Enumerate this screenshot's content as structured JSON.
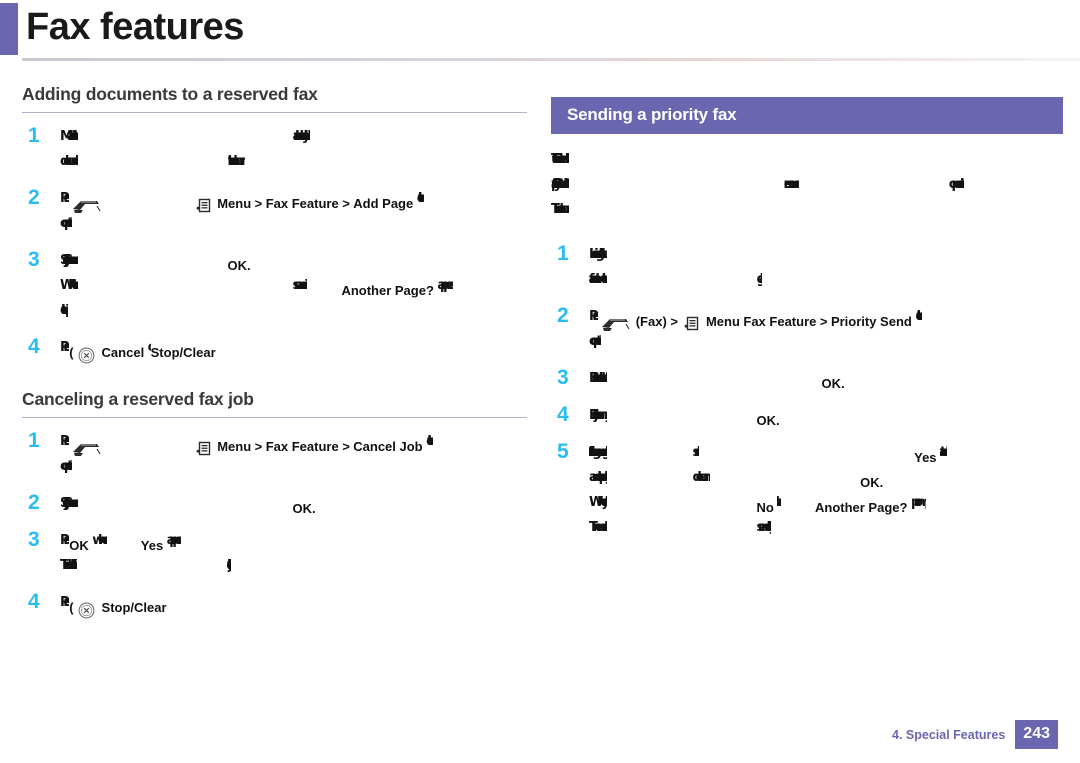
{
  "document": {
    "title": "Fax features",
    "accent_color": "#6b66b0",
    "step_number_color": "#29bdef"
  },
  "left_column": {
    "sections": [
      {
        "heading": "Adding documents to a reserved fax",
        "style": "underlined",
        "steps": [
          {
            "number": "1",
            "lines": [
              {
                "parts": [
                  {
                    "type": "faint",
                    "text": "Make sure that the document is"
                  },
                  {
                    "type": "gap",
                    "size": "xl"
                  },
                  {
                    "type": "faint",
                    "text": "already loaded in the"
                  }
                ]
              },
              {
                "parts": [
                  {
                    "type": "faint",
                    "text": "document feeder. If not, load"
                  },
                  {
                    "type": "gap",
                    "size": "l"
                  },
                  {
                    "type": "faint",
                    "text": "the document."
                  }
                ]
              }
            ]
          },
          {
            "number": "2",
            "lines": [
              {
                "parts": [
                  {
                    "type": "faint",
                    "text": "Press"
                  },
                  {
                    "type": "icon",
                    "name": "fax-icon"
                  },
                  {
                    "type": "gap",
                    "size": "m"
                  },
                  {
                    "type": "icon",
                    "name": "menu-icon"
                  },
                  {
                    "type": "label",
                    "text": "Menu"
                  },
                  {
                    "type": "label",
                    "text": ">"
                  },
                  {
                    "type": "label",
                    "text": "Fax Feature"
                  },
                  {
                    "type": "label",
                    "text": ">"
                  },
                  {
                    "type": "label",
                    "text": "Add Page"
                  },
                  {
                    "type": "faint",
                    "text": "on the"
                  }
                ]
              },
              {
                "parts": [
                  {
                    "type": "faint",
                    "text": "control panel."
                  }
                ]
              }
            ]
          },
          {
            "number": "3",
            "lines": [
              {
                "parts": [
                  {
                    "type": "faint",
                    "text": "Select the fax job you want and press"
                  },
                  {
                    "type": "gap",
                    "size": "l"
                  },
                  {
                    "type": "label",
                    "text": "OK."
                  }
                ]
              },
              {
                "parts": [
                  {
                    "type": "faint",
                    "text": "When the machine has finished"
                  },
                  {
                    "type": "gap",
                    "size": "xl"
                  },
                  {
                    "type": "faint",
                    "text": "scanning,"
                  },
                  {
                    "type": "gap",
                    "size": "s"
                  },
                  {
                    "type": "label",
                    "text": "Another Page?"
                  },
                  {
                    "type": "faint",
                    "text": "appears"
                  }
                ]
              },
              {
                "parts": [
                  {
                    "type": "faint",
                    "text": "on the display."
                  }
                ]
              }
            ]
          },
          {
            "number": "4",
            "lines": [
              {
                "parts": [
                  {
                    "type": "faint",
                    "text": "Press"
                  },
                  {
                    "type": "plain",
                    "text": "("
                  },
                  {
                    "type": "icon",
                    "name": "stop-clear-icon"
                  },
                  {
                    "type": "label",
                    "text": "Cancel"
                  },
                  {
                    "type": "faint",
                    "text": "or"
                  },
                  {
                    "type": "label",
                    "text": "Stop/Clear"
                  },
                  {
                    "type": "faint",
                    "text": ") to exit."
                  }
                ]
              }
            ]
          }
        ]
      },
      {
        "heading": "Canceling a reserved fax job",
        "style": "underlined",
        "steps": [
          {
            "number": "1",
            "lines": [
              {
                "parts": [
                  {
                    "type": "faint",
                    "text": "Press"
                  },
                  {
                    "type": "icon",
                    "name": "fax-icon"
                  },
                  {
                    "type": "gap",
                    "size": "m"
                  },
                  {
                    "type": "icon",
                    "name": "menu-icon"
                  },
                  {
                    "type": "label",
                    "text": "Menu"
                  },
                  {
                    "type": "label",
                    "text": ">"
                  },
                  {
                    "type": "label",
                    "text": "Fax Feature"
                  },
                  {
                    "type": "label",
                    "text": ">"
                  },
                  {
                    "type": "label",
                    "text": "Cancel Job"
                  },
                  {
                    "type": "faint",
                    "text": "on the"
                  }
                ]
              },
              {
                "parts": [
                  {
                    "type": "faint",
                    "text": "control panel."
                  }
                ]
              }
            ]
          },
          {
            "number": "2",
            "lines": [
              {
                "parts": [
                  {
                    "type": "faint",
                    "text": "Select the fax job you want and press"
                  },
                  {
                    "type": "gap",
                    "size": "xl"
                  },
                  {
                    "type": "label",
                    "text": "OK."
                  }
                ]
              }
            ]
          },
          {
            "number": "3",
            "lines": [
              {
                "parts": [
                  {
                    "type": "faint",
                    "text": "Press"
                  },
                  {
                    "type": "label",
                    "text": "OK"
                  },
                  {
                    "type": "faint",
                    "text": "when"
                  },
                  {
                    "type": "gap",
                    "size": "s"
                  },
                  {
                    "type": "label",
                    "text": "Yes"
                  },
                  {
                    "type": "faint",
                    "text": "appears."
                  }
                ]
              },
              {
                "parts": [
                  {
                    "type": "faint",
                    "text": "The selected fax is deleted."
                  },
                  {
                    "type": "gap",
                    "size": "l"
                  },
                  {
                    "type": "faint",
                    "text": "the job."
                  }
                ]
              }
            ]
          },
          {
            "number": "4",
            "lines": [
              {
                "parts": [
                  {
                    "type": "faint",
                    "text": "Press"
                  },
                  {
                    "type": "plain",
                    "text": "("
                  },
                  {
                    "type": "icon",
                    "name": "stop-clear-icon"
                  },
                  {
                    "type": "label",
                    "text": "Stop/Clear"
                  },
                  {
                    "type": "faint",
                    "text": ") to exit."
                  }
                ]
              }
            ]
          }
        ]
      }
    ]
  },
  "right_column": {
    "sections": [
      {
        "heading": "Sending a priority fax",
        "style": "boxed",
        "intro_lines": [
          {
            "parts": [
              {
                "type": "faint",
                "text": "This function is used when a high"
              }
            ]
          },
          {
            "parts": [
              {
                "type": "faint",
                "text": "priority fax needs to be sent ahead of"
              },
              {
                "type": "gap",
                "size": "xl"
              },
              {
                "type": "faint",
                "text": "reserved"
              },
              {
                "type": "gap",
                "size": "l"
              },
              {
                "type": "faint",
                "text": "operations."
              }
            ]
          },
          {
            "parts": [
              {
                "type": "faint",
                "text": "The document is scanned into memory."
              }
            ]
          }
        ],
        "steps": [
          {
            "number": "1",
            "lines": [
              {
                "parts": [
                  {
                    "type": "faint",
                    "text": "Load a single document"
                  }
                ]
              },
              {
                "parts": [
                  {
                    "type": "faint",
                    "text": "face down on the scanner"
                  },
                  {
                    "type": "gap",
                    "size": "l"
                  },
                  {
                    "type": "faint",
                    "text": "glass."
                  }
                ]
              }
            ]
          },
          {
            "number": "2",
            "lines": [
              {
                "parts": [
                  {
                    "type": "faint",
                    "text": "Press"
                  },
                  {
                    "type": "icon",
                    "name": "fax-icon"
                  },
                  {
                    "type": "plain",
                    "text": "(Fax) >"
                  },
                  {
                    "type": "icon",
                    "name": "menu-icon"
                  },
                  {
                    "type": "label",
                    "text": "Menu"
                  },
                  {
                    "type": "label",
                    "text": "Fax Feature"
                  },
                  {
                    "type": "label",
                    "text": ">"
                  },
                  {
                    "type": "label",
                    "text": "Priority Send"
                  },
                  {
                    "type": "faint",
                    "text": "on the"
                  }
                ]
              },
              {
                "parts": [
                  {
                    "type": "faint",
                    "text": "control panel."
                  }
                ]
              }
            ]
          },
          {
            "number": "3",
            "lines": [
              {
                "parts": [
                  {
                    "type": "faint",
                    "text": "Enter the destination fax number and press"
                  },
                  {
                    "type": "gap",
                    "size": "xl"
                  },
                  {
                    "type": "label",
                    "text": "OK."
                  }
                ]
              }
            ]
          },
          {
            "number": "4",
            "lines": [
              {
                "parts": [
                  {
                    "type": "faint",
                    "text": "Enter the job name you want and press"
                  },
                  {
                    "type": "gap",
                    "size": "l"
                  },
                  {
                    "type": "label",
                    "text": "OK."
                  }
                ]
              }
            ]
          },
          {
            "number": "5",
            "lines": [
              {
                "parts": [
                  {
                    "type": "faint",
                    "text": "If you are using the scanner glass,"
                  },
                  {
                    "type": "gap",
                    "size": "m"
                  },
                  {
                    "type": "faint",
                    "text": "select"
                  },
                  {
                    "type": "gap",
                    "size": "xl"
                  },
                  {
                    "type": "label",
                    "text": "Yes"
                  },
                  {
                    "type": "faint",
                    "text": "to add"
                  }
                ]
              },
              {
                "parts": [
                  {
                    "type": "faint",
                    "text": "another page. Load another"
                  },
                  {
                    "type": "gap",
                    "size": "m"
                  },
                  {
                    "type": "faint",
                    "text": "document and press"
                  },
                  {
                    "type": "gap",
                    "size": "l"
                  },
                  {
                    "type": "label",
                    "text": "OK."
                  }
                ]
              },
              {
                "parts": [
                  {
                    "type": "faint",
                    "text": "When you have finished, select"
                  },
                  {
                    "type": "gap",
                    "size": "l"
                  },
                  {
                    "type": "label",
                    "text": "No"
                  },
                  {
                    "type": "faint",
                    "text": "at the"
                  },
                  {
                    "type": "gap",
                    "size": "s"
                  },
                  {
                    "type": "label",
                    "text": "Another Page?"
                  },
                  {
                    "type": "faint",
                    "text": "prompt."
                  }
                ]
              },
              {
                "parts": [
                  {
                    "type": "faint",
                    "text": "The machine starts"
                  },
                  {
                    "type": "gap",
                    "size": "l"
                  },
                  {
                    "type": "faint",
                    "text": "sending the fax."
                  }
                ]
              }
            ]
          }
        ]
      }
    ]
  },
  "footer": {
    "chapter": "4.  Special Features",
    "page_number": "243"
  }
}
